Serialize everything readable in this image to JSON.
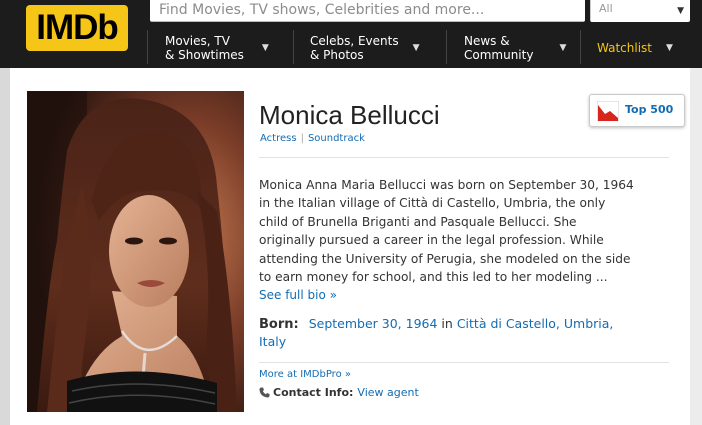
{
  "header": {
    "logo": "IMDb",
    "search_placeholder": "Find Movies, TV shows, Celebrities and more...",
    "search_scope": "All",
    "nav": [
      {
        "line1": "Movies, TV",
        "line2": "& Showtimes"
      },
      {
        "line1": "Celebs, Events",
        "line2": "& Photos"
      },
      {
        "line1": "News &",
        "line2": "Community"
      }
    ],
    "watchlist": "Watchlist"
  },
  "profile": {
    "name": "Monica Bellucci",
    "jobs": [
      "Actress",
      "Soundtrack"
    ],
    "top500_label": "Top 500",
    "bio_lines": [
      "Monica Anna Maria Bellucci was born on September 30, 1964",
      "in the Italian village of Città di Castello, Umbria, the only",
      "child of Brunella Briganti and Pasquale Bellucci. She",
      "originally pursued a career in the legal profession. While",
      "attending the University of Perugia, she modeled on the side",
      "to earn money for school, and this led to her modeling ..."
    ],
    "see_full_bio": "See full bio »",
    "born_label": "Born:",
    "born_date": "September 30, 1964",
    "born_in": "in",
    "born_place": "Città di Castello, Umbria,",
    "born_country": "Italy",
    "more_pro": "More at IMDbPro »",
    "contact_label": "Contact Info:",
    "contact_link": "View agent"
  },
  "colors": {
    "brand": "#f5c518",
    "link": "#136cb2",
    "header_bg": "#1c1c1c"
  }
}
